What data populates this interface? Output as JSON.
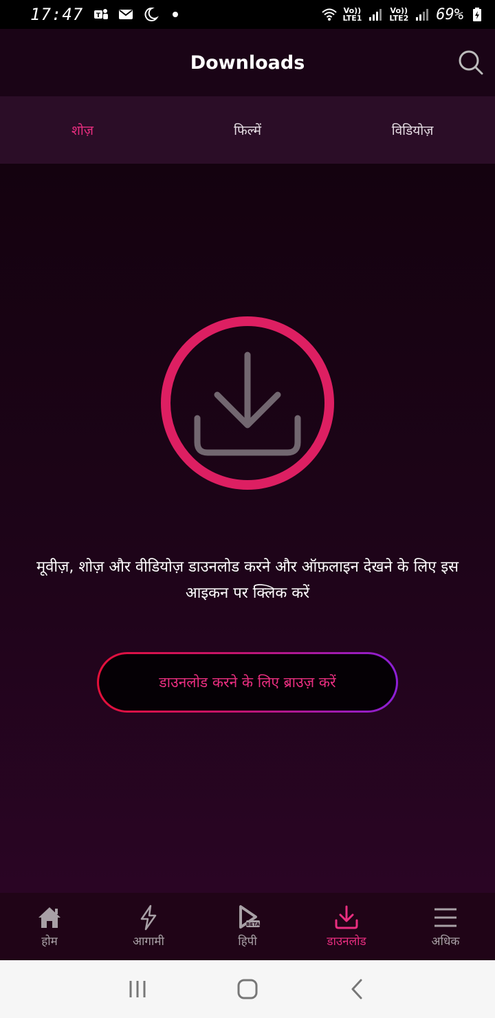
{
  "status_bar": {
    "time": "17:47",
    "sim1": "LTE1",
    "sim2": "LTE2",
    "volte1": "Vo))",
    "volte2": "Vo))",
    "battery": "69%",
    "icons": [
      "teams-icon",
      "mail-icon",
      "moon-icon",
      "dot-icon",
      "wifi-icon",
      "signal-icon",
      "battery-icon"
    ]
  },
  "header": {
    "title": "Downloads"
  },
  "tabs": [
    {
      "label": "शोज़",
      "active": true
    },
    {
      "label": "फिल्में",
      "active": false
    },
    {
      "label": "विडियोज़",
      "active": false
    }
  ],
  "main": {
    "empty_message": "मूवीज़, शोज़ और वीडियोज़ डाउनलोड करने और ऑफ़लाइन देखने के लिए इस आइकन पर क्लिक करें",
    "browse_button": "डाउनलोड करने के लिए ब्राउज़ करें"
  },
  "bottom_nav": [
    {
      "label": "होम",
      "icon": "home-icon",
      "active": false
    },
    {
      "label": "आगामी",
      "icon": "lightning-icon",
      "active": false
    },
    {
      "label": "हिपी",
      "icon": "hipi-icon",
      "badge": "BETA",
      "active": false
    },
    {
      "label": "डाउनलोड",
      "icon": "download-icon",
      "active": true
    },
    {
      "label": "अधिक",
      "icon": "menu-icon",
      "active": false
    }
  ],
  "colors": {
    "accent": "#ea2e80",
    "ring": "#dd1f62",
    "background": "#14020f",
    "tab_bar": "#2b0d27"
  }
}
